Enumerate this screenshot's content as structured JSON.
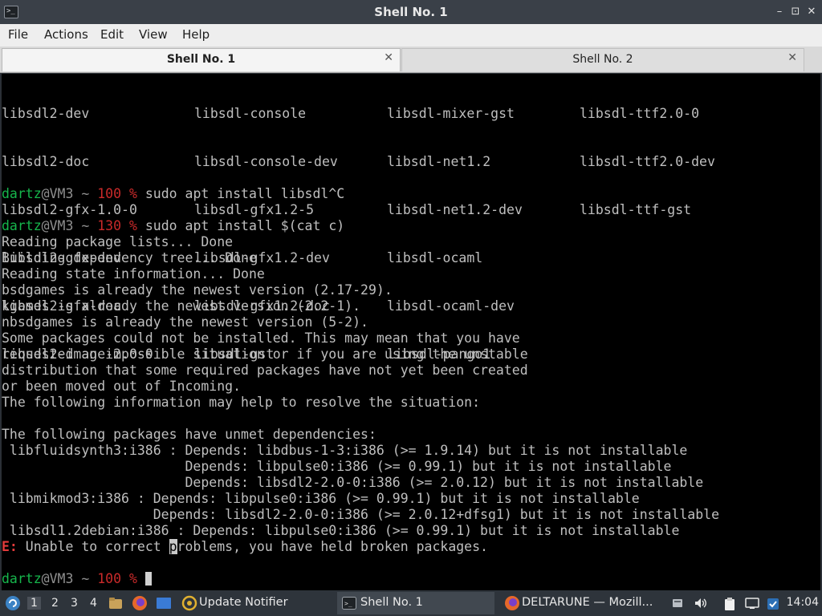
{
  "window": {
    "title": "Shell No. 1",
    "minimize": "–",
    "maximize": "⊡",
    "close": "✕",
    "icon": "terminal-icon"
  },
  "menu": [
    "File",
    "Actions",
    "Edit",
    "View",
    "Help"
  ],
  "tabs": [
    {
      "label": "Shell No. 1",
      "close": "✕"
    },
    {
      "label": "Shell No. 2",
      "close": "✕"
    }
  ],
  "terminal": {
    "package_columns": [
      [
        "libsdl2-dev",
        "libsdl2-doc",
        "libsdl2-gfx-1.0-0",
        "libsdl2-gfx-dev",
        "libsdl2-gfx-doc",
        "libsdl2-image-2.0-0"
      ],
      [
        "libsdl-console",
        "libsdl-console-dev",
        "libsdl-gfx1.2-5",
        "libsdl-gfx1.2-dev",
        "libsdl-gfx1.2-doc",
        "libsdl-gst"
      ],
      [
        "libsdl-mixer-gst",
        "libsdl-net1.2",
        "libsdl-net1.2-dev",
        "libsdl-ocaml",
        "libsdl-ocaml-dev",
        "libsdl-pango1"
      ],
      [
        "libsdl-ttf2.0-0",
        "libsdl-ttf2.0-dev",
        "libsdl-ttf-gst"
      ]
    ],
    "prompt_user": "dartz",
    "prompt_host": "@VM3 ~ ",
    "prompts": [
      {
        "status": "100",
        "command": " sudo apt install libsdl^C"
      },
      {
        "status": "130",
        "command": " sudo apt install $(cat c)"
      },
      {
        "status": "100",
        "command": " "
      }
    ],
    "percent": "%",
    "output_lines": [
      "Reading package lists... Done",
      "Building dependency tree... Done",
      "Reading state information... Done",
      "bsdgames is already the newest version (2.17-29).",
      "kgames is already the newest version (2.2-1).",
      "nbsdgames is already the newest version (5-2).",
      "Some packages could not be installed. This may mean that you have",
      "requested an impossible situation or if you are using the unstable",
      "distribution that some required packages have not yet been created",
      "or been moved out of Incoming.",
      "The following information may help to resolve the situation:",
      "",
      "The following packages have unmet dependencies:",
      " libfluidsynth3:i386 : Depends: libdbus-1-3:i386 (>= 1.9.14) but it is not installable",
      "                       Depends: libpulse0:i386 (>= 0.99.1) but it is not installable",
      "                       Depends: libsdl2-2.0-0:i386 (>= 2.0.12) but it is not installable",
      " libmikmod3:i386 : Depends: libpulse0:i386 (>= 0.99.1) but it is not installable",
      "                   Depends: libsdl2-2.0-0:i386 (>= 2.0.12+dfsg1) but it is not installable",
      " libsdl1.2debian:i386 : Depends: libpulse0:i386 (>= 0.99.1) but it is not installable"
    ],
    "error_prefix": "E:",
    "error_before": " Unable to correct ",
    "error_cursor_char": "p",
    "error_after": "roblems, you have held broken packages."
  },
  "taskbar": {
    "workspaces": [
      "1",
      "2",
      "3",
      "4"
    ],
    "tasks": [
      {
        "label": "Update Notifier",
        "icon": "update-notifier-icon"
      },
      {
        "label": "Shell No. 1",
        "icon": "terminal-icon"
      },
      {
        "label": "DELTARUNE — Mozill...",
        "icon": "firefox-icon"
      }
    ],
    "clock": "14:04"
  },
  "colors": {
    "prompt_user": "#16b64c",
    "status": "#c92a2a",
    "error": "#e33b3b"
  }
}
